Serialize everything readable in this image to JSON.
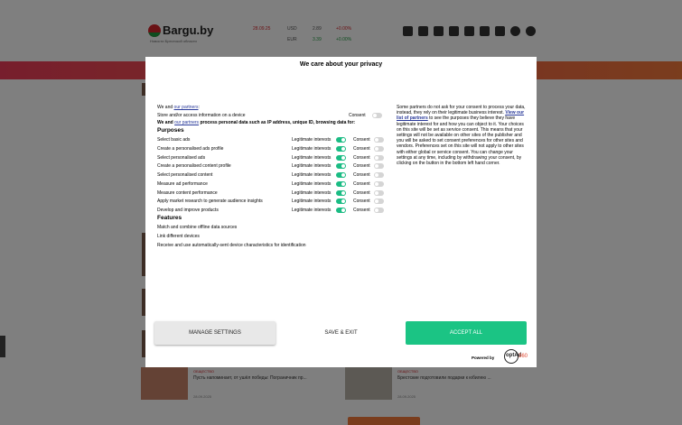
{
  "site": {
    "logo": "Bargu.by",
    "logo_sub": "Новости Брестской области",
    "rates": [
      {
        "label": "28.09.25",
        "color": "red"
      },
      {
        "label": "USD",
        "color": "gray"
      },
      {
        "label": "2.89",
        "color": "gray"
      },
      {
        "label": "+0.00%",
        "color": "red"
      },
      {
        "label": "EUR",
        "color": "gray"
      },
      {
        "label": "3.39",
        "color": "green"
      },
      {
        "label": "+0.00%",
        "color": "green"
      }
    ],
    "socials": [
      "twitter-icon",
      "facebook-icon",
      "vk-icon",
      "ok-icon",
      "telegram-icon",
      "instagram-icon",
      "linkedin-icon",
      "tiktok-icon",
      "viber-icon"
    ],
    "news": [
      {
        "tag": "ОБЩЕСТВО",
        "title": "Пусть напоминает, от ушёл победы: Пограничник пр...",
        "date": "28.09.2025"
      },
      {
        "tag": "ОБЩЕСТВО",
        "title": "Брестские подготовили подарки к юбилею ...",
        "date": "28.09.2025"
      }
    ]
  },
  "modal": {
    "title": "We care about your privacy",
    "we_and": "We and",
    "our_partners": "our partners",
    "store_line": "Store and/or access information on a device",
    "process_suffix": "process personal data such as IP address, unique ID, browsing data for:",
    "purposes_title": "Purposes",
    "features_title": "Features",
    "legit_label": "Legitimate interests",
    "consent_label": "Consent",
    "purposes": [
      "Select basic ads",
      "Create a personalised ads profile",
      "Select personalised ads",
      "Create a personalised content profile",
      "Select personalised content",
      "Measure ad performance",
      "Measure content performance",
      "Apply market research to generate audience insights",
      "Develop and improve products"
    ],
    "features": [
      "Match and combine offline data sources",
      "Link different devices",
      "Receive and use automatically-sent device characteristics for identification"
    ],
    "right_text_1": "Some partners do not ask for your consent to process your data, instead, they rely on their legitimate business interest.",
    "right_link": "View our list of partners",
    "right_text_2": "to see the purposes they believe they have legitimate interest for and how you can object to it. Your choices on this site will be set as service consent. This means that your settings will not be available on other sites of the publisher and you will be asked to set consent preferences for other sites and vendors. Preferences set on this site will not apply to other sites with either global or service consent. You can change your settings at any time, including by withdrawing your consent, by clicking on the button in the bottom left hand corner.",
    "buttons": {
      "manage": "MANAGE SETTINGS",
      "save": "SAVE & EXIT",
      "accept": "ACCEPT ALL"
    },
    "powered_by": "Powered by",
    "brand": "optAd",
    "brand_num": "360",
    "colors": {
      "accent": "#1bc484",
      "link": "#2a3a9a"
    }
  }
}
